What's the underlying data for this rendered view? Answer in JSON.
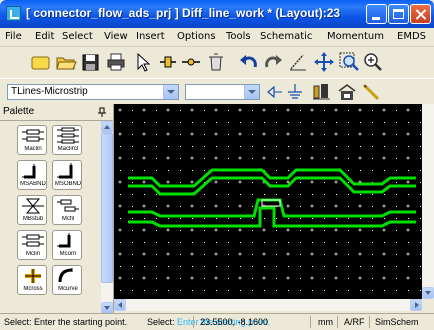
{
  "window": {
    "title": "[ connector_flow_ads_prj ] Diff_line_work * (Layout):23"
  },
  "menu": [
    "File",
    "Edit",
    "Select",
    "View",
    "Insert",
    "Options",
    "Tools",
    "Schematic",
    "Momentum",
    "EMDS"
  ],
  "toolbar": {
    "icons": [
      "new-icon",
      "open-icon",
      "save-icon",
      "print-icon",
      "select-pointer-icon",
      "insert-component-icon",
      "insert-port-icon",
      "delete-icon",
      "undo-icon",
      "redo-icon",
      "measure-icon",
      "move-icon",
      "zoom-area-icon",
      "zoom-in-icon"
    ]
  },
  "toolbar2": {
    "library_combo": "TLines-Microstrip",
    "component_combo": "",
    "icons": [
      "port-icon",
      "ground-icon",
      "simulate-icon",
      "home-icon",
      "wire-icon"
    ]
  },
  "palette": {
    "title": "Palette",
    "items": [
      {
        "label": "Maclin",
        "icon": "coupled-lines-icon"
      },
      {
        "label": "Maclin3",
        "icon": "coupled-lines-3-icon"
      },
      {
        "label": "MSABND",
        "icon": "arbitrary-bend-icon"
      },
      {
        "label": "MSOBND",
        "icon": "optimal-bend-icon"
      },
      {
        "label": "MBstub",
        "icon": "butterfly-stub-icon"
      },
      {
        "label": "Mcfil",
        "icon": "coupled-filter-icon"
      },
      {
        "label": "Mclin",
        "icon": "coupled-line-icon"
      },
      {
        "label": "Mcorn",
        "icon": "corner-icon"
      },
      {
        "label": "Mcross",
        "icon": "cross-icon"
      },
      {
        "label": "Mcurve",
        "icon": "curve-icon"
      }
    ]
  },
  "status": {
    "message": "Select: Enter the starting point.",
    "overlay_prefix": "Select:",
    "overlay": "Enter the starting point.",
    "coords": "23.5500, -8.1600",
    "units": "mm",
    "mode": "A/RF",
    "sim": "SimSchem"
  },
  "colors": {
    "trace": "#00e000",
    "canvas": "#000000",
    "grid": "#ffffff"
  }
}
